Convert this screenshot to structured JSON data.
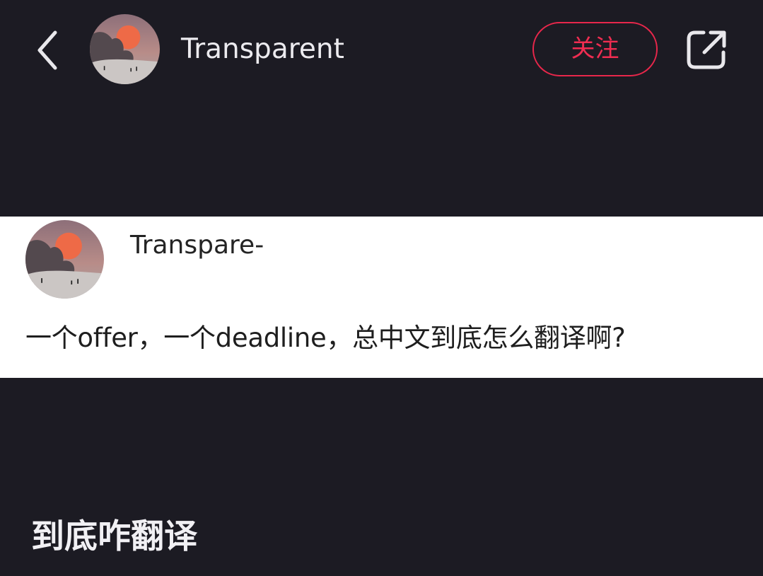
{
  "header": {
    "username": "Transparent",
    "follow_label": "关注",
    "icons": {
      "back": "chevron-left-icon",
      "share": "share-external-icon"
    }
  },
  "post": {
    "author": "Transpare-",
    "text": "一个offer，一个deadline，总中文到底怎么翻译啊?"
  },
  "caption": "到底咋翻译",
  "colors": {
    "background": "#1c1b23",
    "accent": "#e8274b",
    "card": "#ffffff"
  }
}
